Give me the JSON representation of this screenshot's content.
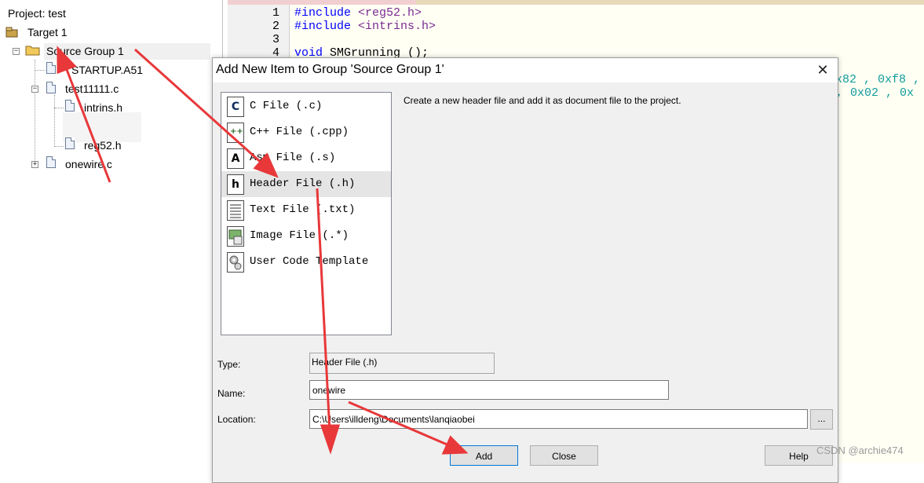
{
  "project": {
    "title": "Project: test",
    "target": "Target 1",
    "group": "Source Group 1",
    "files": [
      "STARTUP.A51",
      "test11111.c",
      "intrins.h",
      "reg52.h",
      "onewire.c"
    ]
  },
  "editor": {
    "line_numbers": [
      "1",
      "2",
      "3",
      "4"
    ],
    "lines": {
      "l1_dir": "#include",
      "l1_file": " <reg52.h>",
      "l2_dir": "#include",
      "l2_file": " <intrins.h>",
      "l4_kw": "void",
      "l4_rest": " SMGrunning ();"
    },
    "right_fragments": [
      "x82 , 0xf8 ,",
      ", 0x02 , 0x"
    ]
  },
  "dialog": {
    "title": "Add New Item to Group 'Source Group 1'",
    "close_glyph": "✕",
    "templates": [
      {
        "icon": "C",
        "label": "C File (.c)"
      },
      {
        "icon": "C++",
        "label": "C++ File (.cpp)"
      },
      {
        "icon": "A",
        "label": "Asm File (.s)"
      },
      {
        "icon": "h",
        "label": "Header File (.h)"
      },
      {
        "icon": "txt",
        "label": "Text File (.txt)"
      },
      {
        "icon": "img",
        "label": "Image File (.*)"
      },
      {
        "icon": "gear",
        "label": "User Code Template"
      }
    ],
    "selected_template": "Header File (.h)",
    "description": "Create a new header file and add it as document file to the project.",
    "type_label": "Type:",
    "type_value": "Header File (.h)",
    "name_label": "Name:",
    "name_value": "onewire",
    "location_label": "Location:",
    "location_value": "C:\\Users\\illdeng\\Documents\\lanqiaobei",
    "browse_label": "...",
    "add_label": "Add",
    "close_label": "Close",
    "help_label": "Help"
  },
  "watermark": "CSDN @archie474",
  "colors": {
    "annotation_red": "#e8383a",
    "editor_bg": "#fffff4",
    "preprocessor": "#7a2b91",
    "keyword": "#0000ff",
    "hex": "#139c9c"
  }
}
